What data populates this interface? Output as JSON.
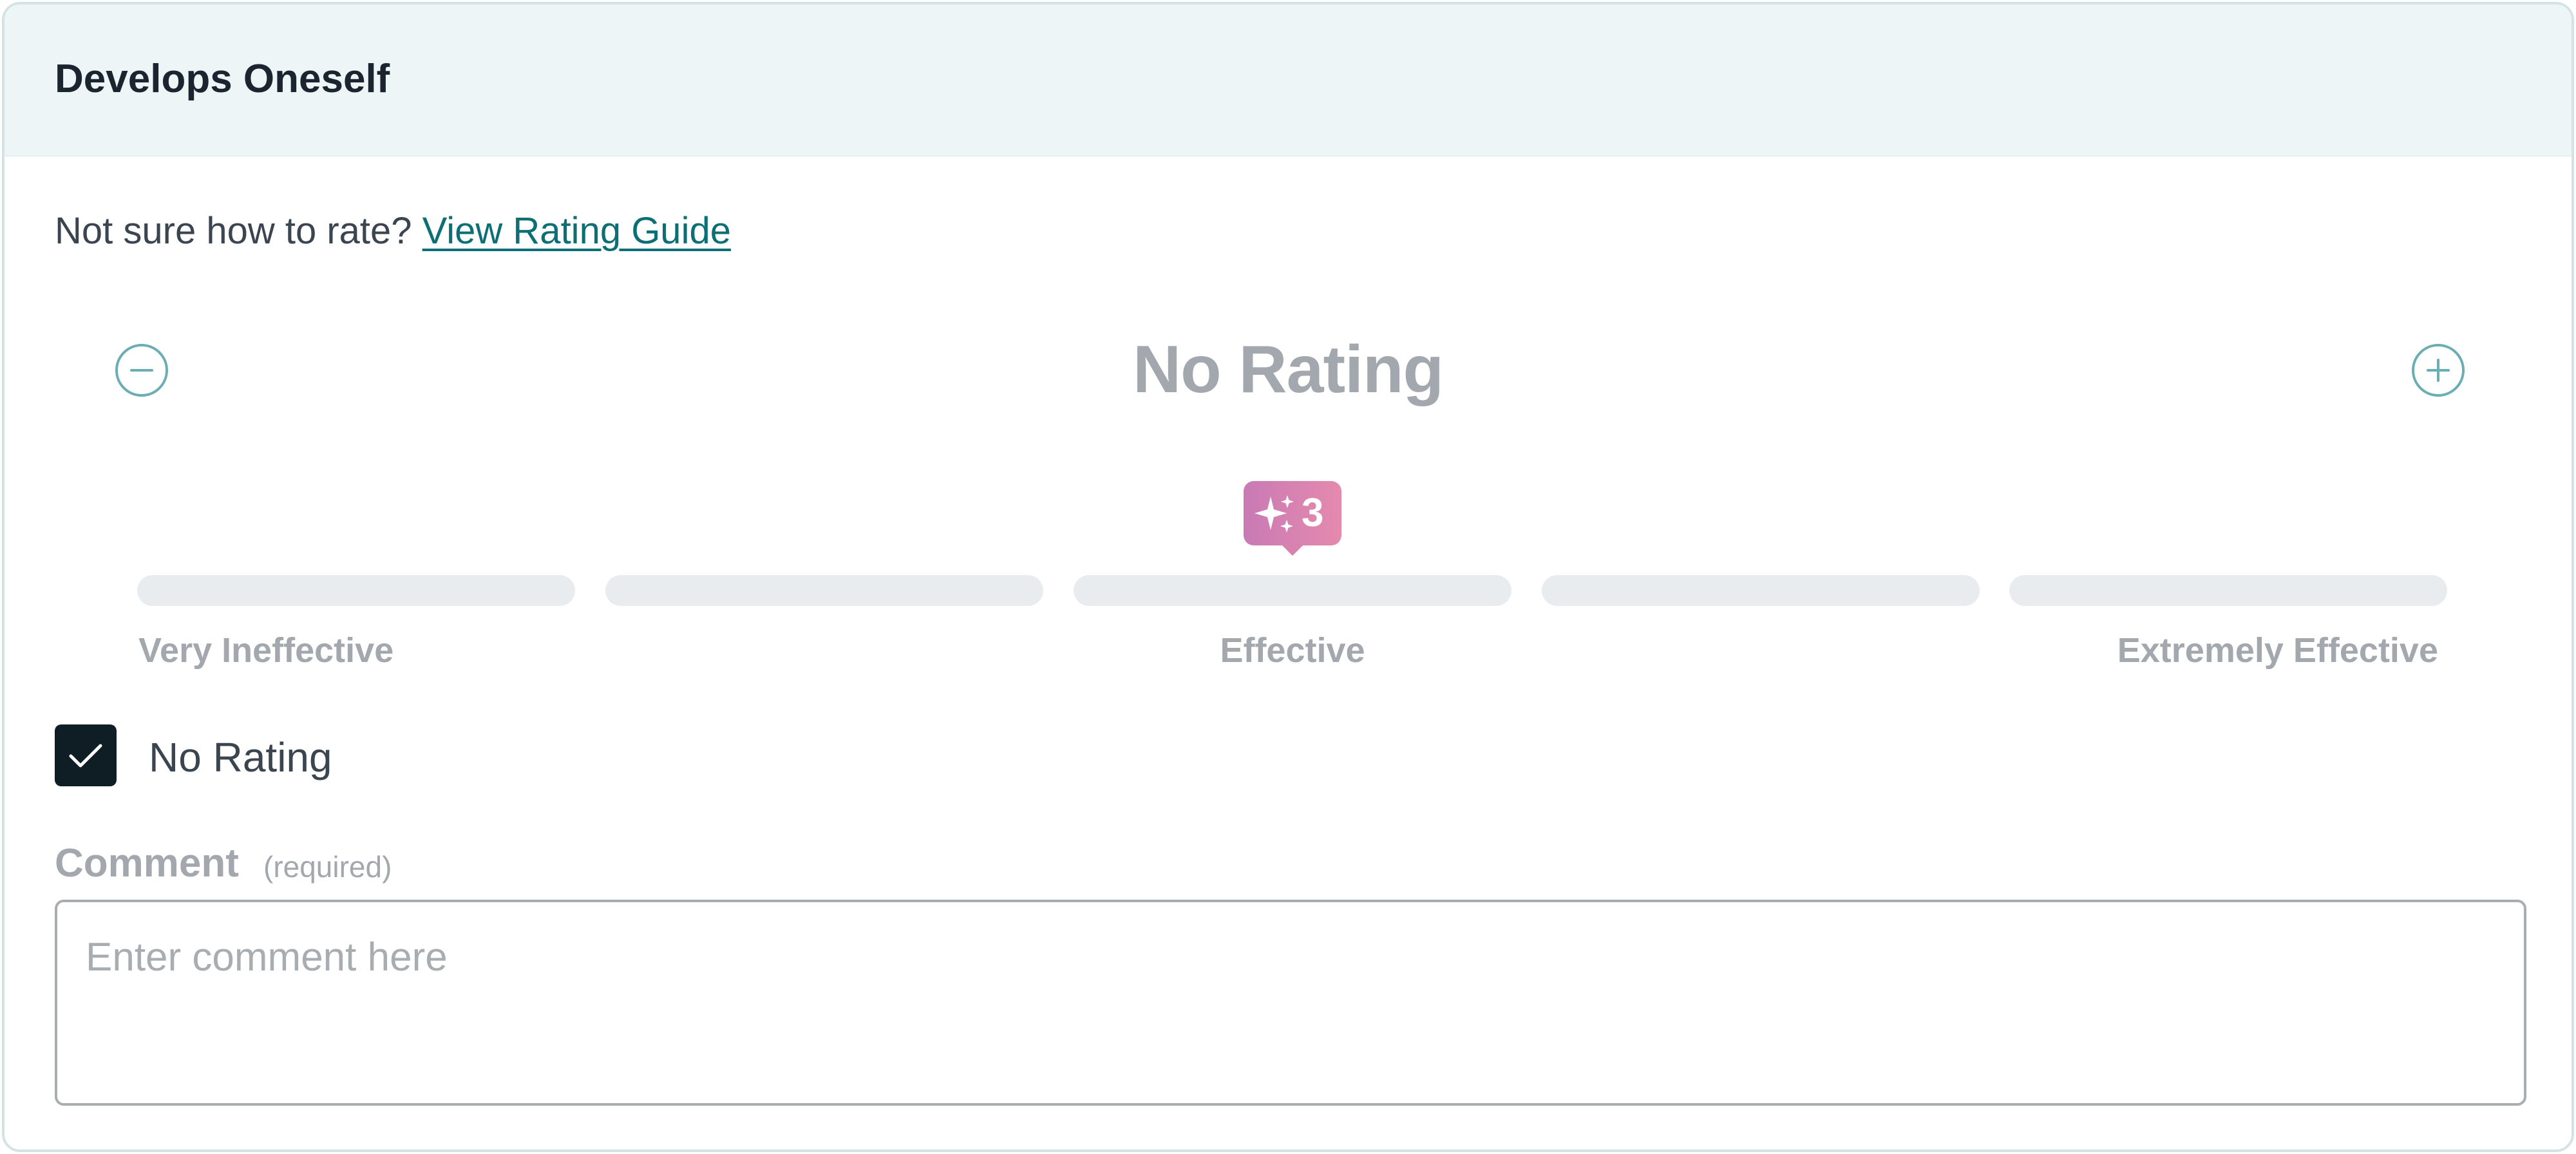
{
  "section": {
    "title": "Develops Oneself"
  },
  "guide": {
    "prompt": "Not sure how to rate?",
    "link_label": "View Rating Guide"
  },
  "rating": {
    "current_label": "No Rating",
    "decrease_icon": "minus-circle-icon",
    "increase_icon": "plus-circle-icon",
    "badge": {
      "icon": "sparkles-icon",
      "count": "3",
      "gradient_start": "#c97ab4",
      "gradient_end": "#e58aae"
    },
    "scale_label_left": "Very Ineffective",
    "scale_label_middle": "Effective",
    "scale_label_right": "Extremely Effective",
    "segment_count": 5
  },
  "no_rating_option": {
    "label": "No Rating",
    "checked": true
  },
  "comment": {
    "label": "Comment",
    "hint": "(required)",
    "placeholder": "Enter comment here",
    "value": ""
  },
  "colors": {
    "accent": "#0c6f74",
    "header_background": "#eef5f6",
    "muted_text": "#a3a8ae",
    "checkbox_fill": "#0f1e24"
  }
}
